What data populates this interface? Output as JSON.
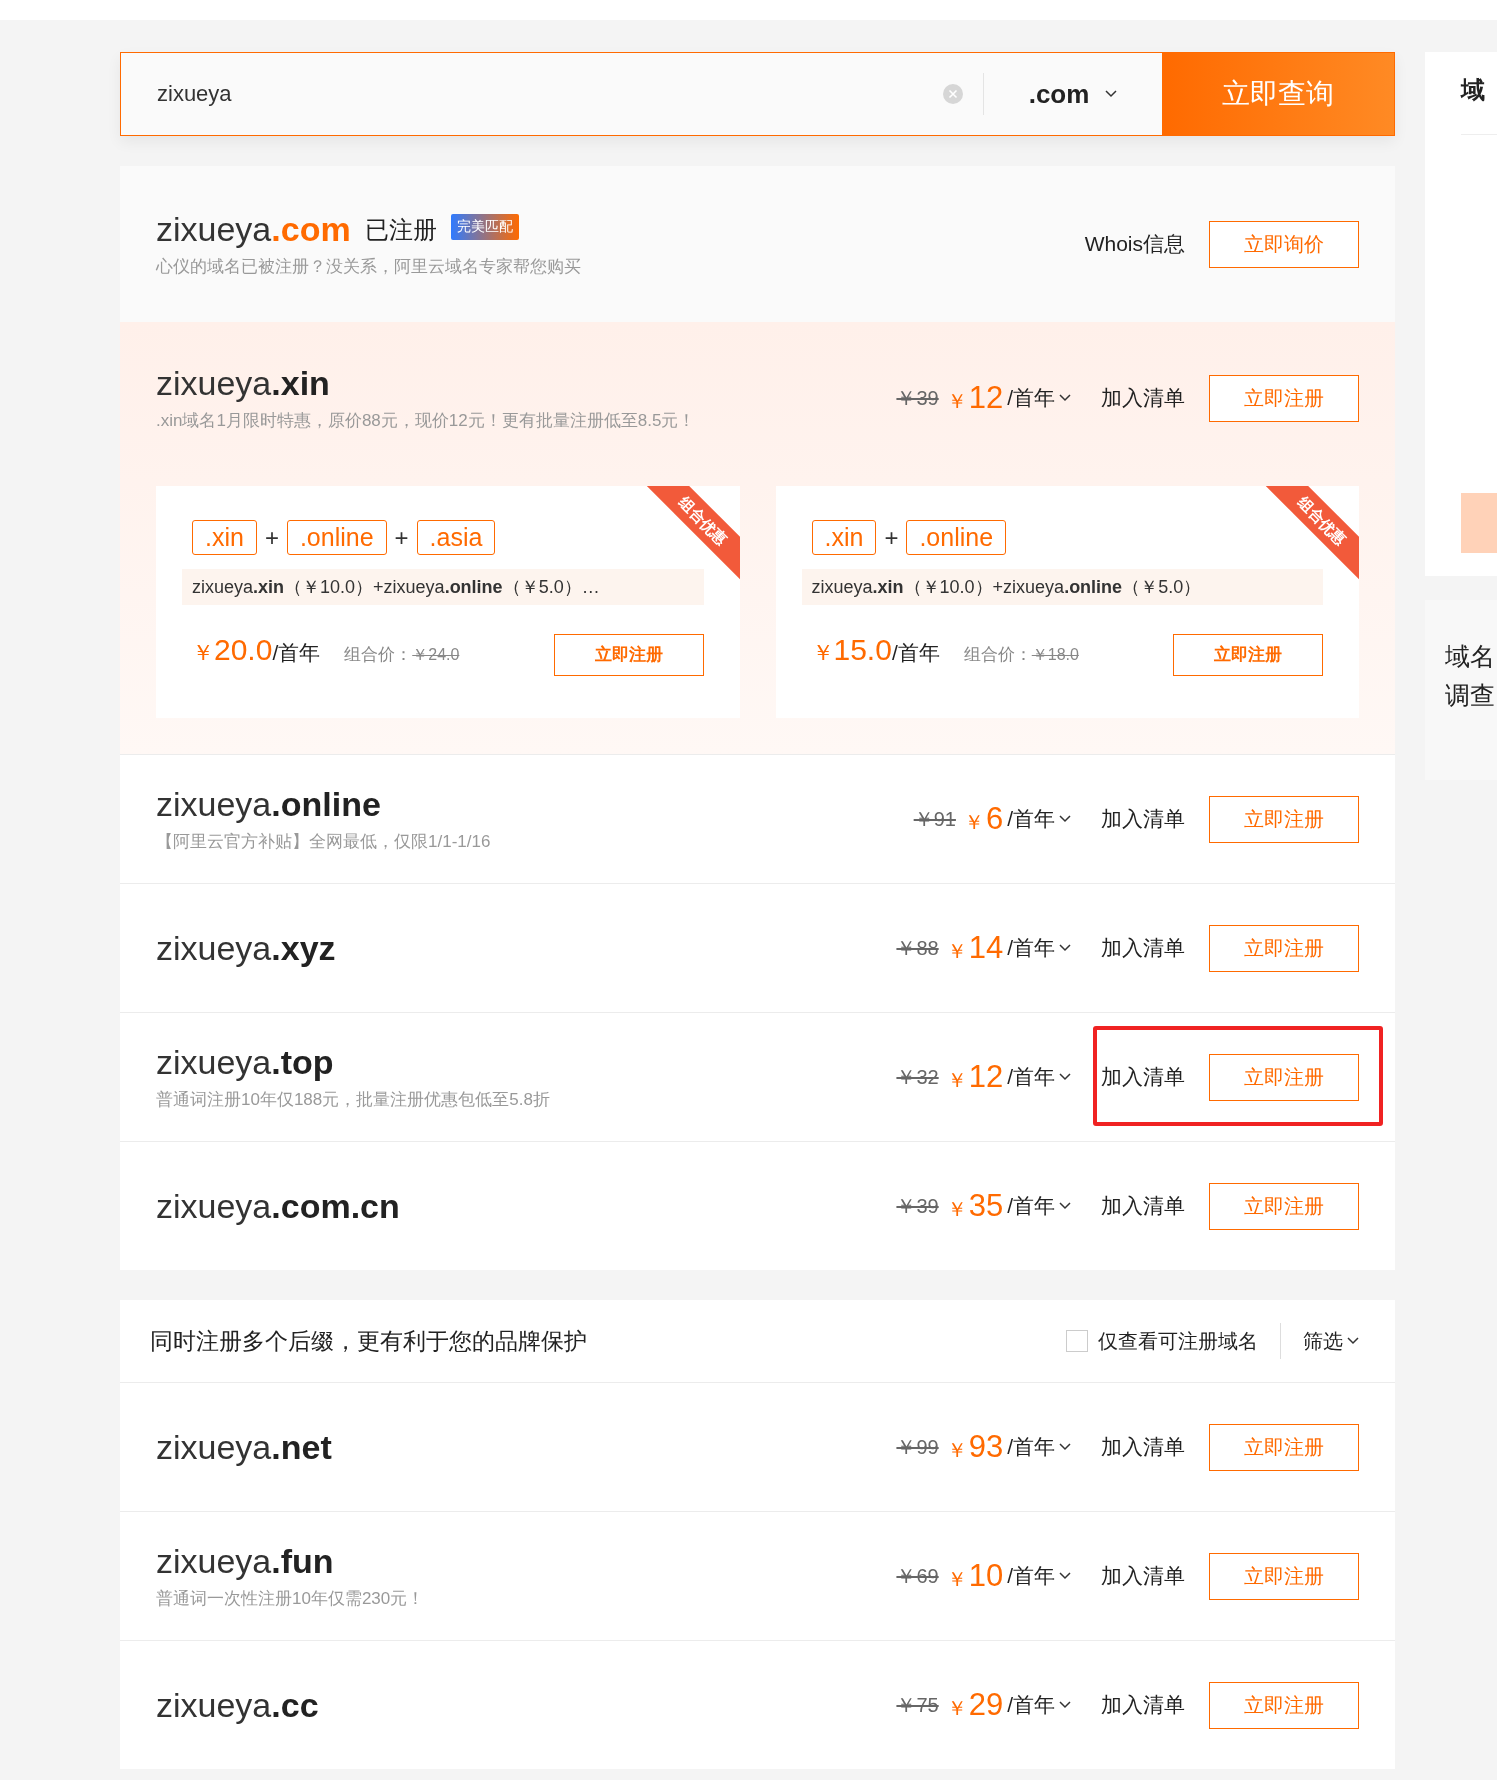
{
  "search": {
    "value": "zixueya",
    "suffix": ".com",
    "button": "立即查询"
  },
  "registered": {
    "name": "zixueya**.com**",
    "status": "已注册",
    "badge": "完美匹配",
    "note": "心仪的域名已被注册？没关系，阿里云域名专家帮您购买",
    "whois": "Whois信息",
    "button": "立即询价"
  },
  "featured": {
    "name": "zixueya**.xin**",
    "note": ".xin域名1月限时特惠，原价88元，现价12元！更有批量注册低至8.5元！",
    "original_price": "￥39",
    "currency": "￥",
    "price": "12",
    "unit": "/首年",
    "add": "加入清单",
    "button": "立即注册",
    "bundles": [
      {
        "ribbon": "组合优惠",
        "joiner": "+",
        "tags": [
          ".xin",
          ".online",
          ".asia"
        ],
        "summary": "zixueya**.xin**（￥10.0）+zixueya**.online**（￥5.0）…",
        "currency": "￥",
        "price": "20.0",
        "unit": "/首年",
        "combo_label": "组合价：",
        "combo_price": "￥24.0",
        "button": "立即注册"
      },
      {
        "ribbon": "组合优惠",
        "joiner": "+",
        "tags": [
          ".xin",
          ".online"
        ],
        "summary": "zixueya**.xin**（￥10.0）+zixueya**.online**（￥5.0）",
        "currency": "￥",
        "price": "15.0",
        "unit": "/首年",
        "combo_label": "组合价：",
        "combo_price": "￥18.0",
        "button": "立即注册"
      }
    ]
  },
  "rows": [
    {
      "name": "zixueya**.online**",
      "note": "【阿里云官方补贴】全网最低，仅限1/1-1/16",
      "original_price": "￥91",
      "currency": "￥",
      "price": "6",
      "unit": "/首年",
      "add": "加入清单",
      "button": "立即注册",
      "highlighted": false
    },
    {
      "name": "zixueya**.xyz**",
      "original_price": "￥88",
      "currency": "￥",
      "price": "14",
      "unit": "/首年",
      "add": "加入清单",
      "button": "立即注册",
      "highlighted": false
    },
    {
      "name": "zixueya**.top**",
      "note": "普通词注册10年仅188元，批量注册优惠包低至5.8折",
      "original_price": "￥32",
      "currency": "￥",
      "price": "12",
      "unit": "/首年",
      "add": "加入清单",
      "button": "立即注册",
      "highlighted": true
    },
    {
      "name": "zixueya**.com.cn**",
      "original_price": "￥39",
      "currency": "￥",
      "price": "35",
      "unit": "/首年",
      "add": "加入清单",
      "button": "立即注册",
      "highlighted": false
    }
  ],
  "more": {
    "title": "同时注册多个后缀，更有利于您的品牌保护",
    "filter_checkbox": {
      "label": "仅查看可注册域名",
      "checked": false
    },
    "filter": "筛选",
    "rows": [
      {
        "name": "zixueya**.net**",
        "original_price": "￥99",
        "currency": "￥",
        "price": "93",
        "unit": "/首年",
        "add": "加入清单",
        "button": "立即注册",
        "highlighted": false
      },
      {
        "name": "zixueya**.fun**",
        "note": "普通词一次性注册10年仅需230元！",
        "original_price": "￥69",
        "currency": "￥",
        "price": "10",
        "unit": "/首年",
        "add": "加入清单",
        "button": "立即注册",
        "highlighted": false
      },
      {
        "name": "zixueya**.cc**",
        "original_price": "￥75",
        "currency": "￥",
        "price": "29",
        "unit": "/首年",
        "add": "加入清单",
        "button": "立即注册",
        "highlighted": false
      }
    ]
  },
  "sidebar": {
    "title": "域",
    "text_lines": [
      "域名",
      "调查"
    ]
  }
}
